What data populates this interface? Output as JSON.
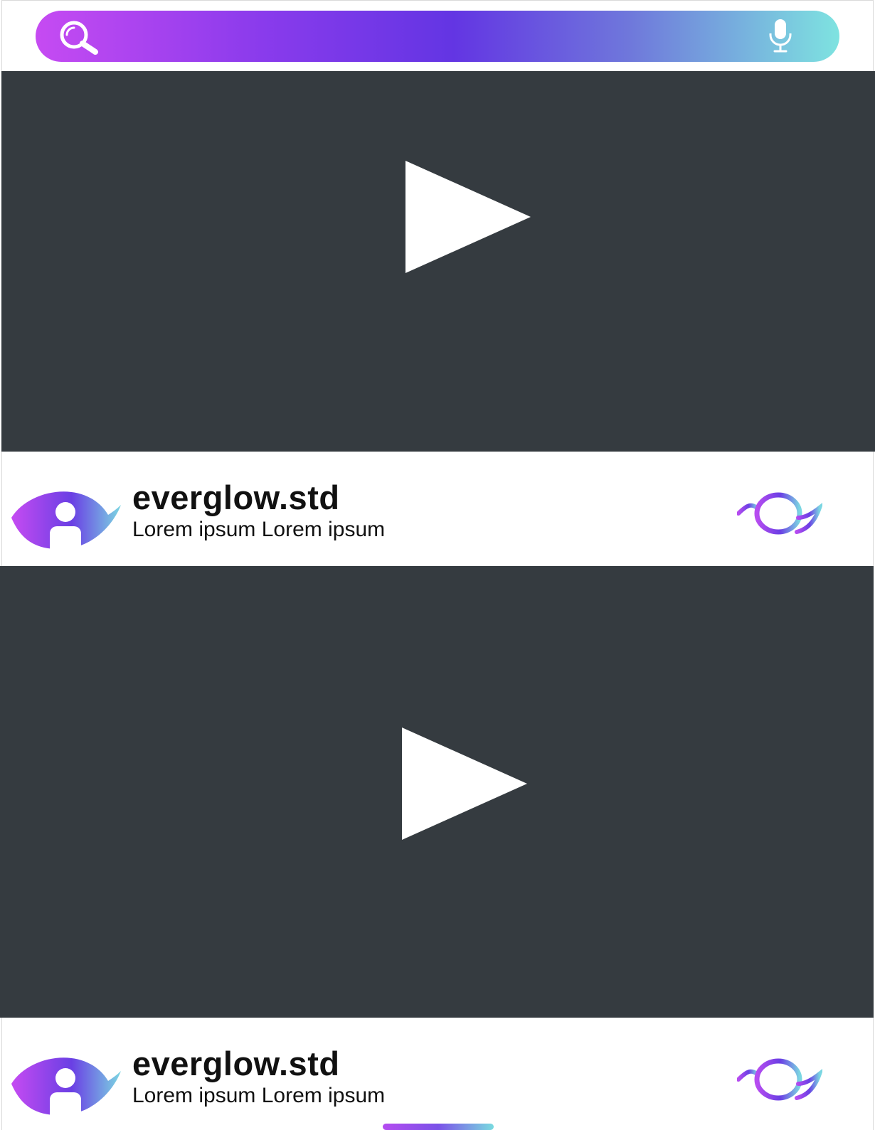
{
  "colors": {
    "gradient_start": "#c64bf2",
    "gradient_mid": "#6335e3",
    "gradient_end": "#7ee3e0",
    "video_background": "#353b40",
    "text": "#111111"
  },
  "search_bar": {
    "search_icon": "search-icon",
    "mic_icon": "microphone-icon"
  },
  "feed": [
    {
      "video": {
        "icon": "play-icon"
      },
      "channel_name": "everglow.std",
      "subtitle": "Lorem ipsum Lorem ipsum",
      "avatar_icon": "user-avatar-icon",
      "action_icon": "eye-icon"
    },
    {
      "video": {
        "icon": "play-icon"
      },
      "channel_name": "everglow.std",
      "subtitle": "Lorem ipsum Lorem ipsum",
      "avatar_icon": "user-avatar-icon",
      "action_icon": "eye-icon"
    }
  ]
}
